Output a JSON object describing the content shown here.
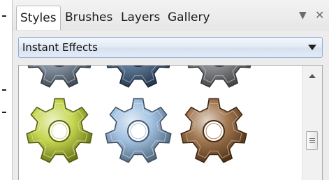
{
  "tabs": [
    {
      "label": "Styles",
      "active": true
    },
    {
      "label": "Brushes",
      "active": false
    },
    {
      "label": "Layers",
      "active": false
    },
    {
      "label": "Gallery",
      "active": false
    }
  ],
  "panel_controls": {
    "menu_icon": "triangle-down-icon",
    "close_icon": "close-icon"
  },
  "preset_select": {
    "value": "Instant Effects"
  },
  "gallery": {
    "items": [
      {
        "name": "silver gear",
        "color": "#6f7f93"
      },
      {
        "name": "blue gear",
        "color": "#3c5d82"
      },
      {
        "name": "gray gear",
        "color": "#74777a"
      },
      {
        "name": "lime gear",
        "color": "#b6cc24"
      },
      {
        "name": "ice gear",
        "color": "#8bb2d9"
      },
      {
        "name": "bronze gear",
        "color": "#8a5524"
      }
    ]
  },
  "colors": {
    "accent_border": "#8fb0d4"
  }
}
